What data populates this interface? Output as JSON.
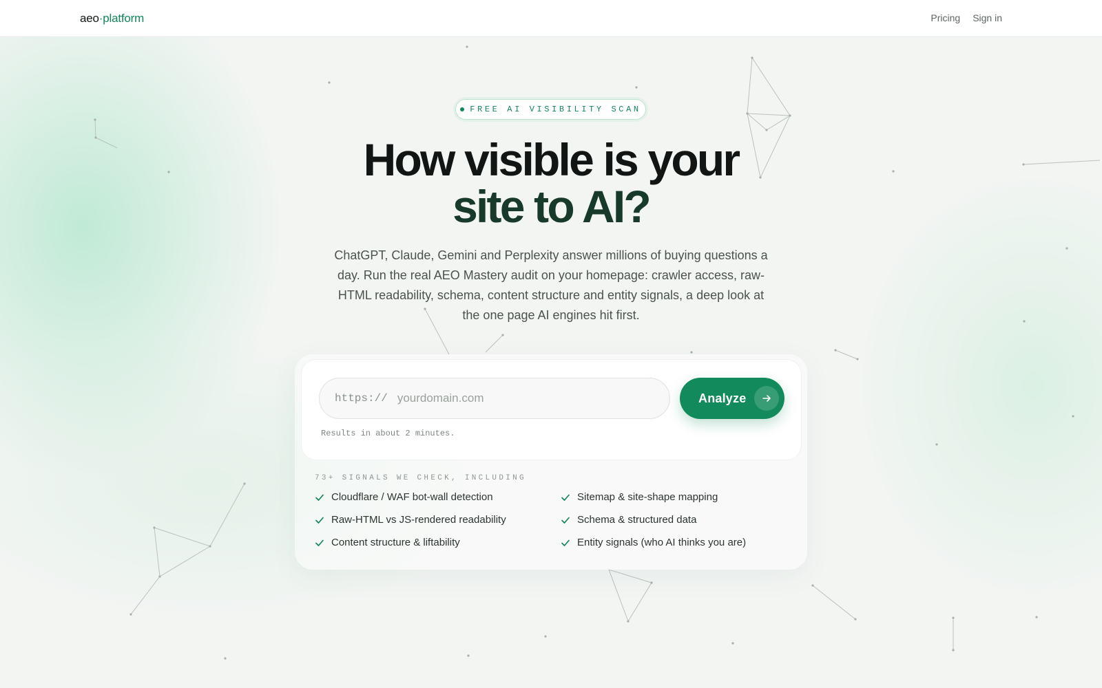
{
  "header": {
    "brand": {
      "part1": "aeo",
      "dot": "·",
      "part2": "platform"
    },
    "nav": [
      {
        "label": "Pricing"
      },
      {
        "label": "Sign in"
      }
    ]
  },
  "hero": {
    "badge": "FREE AI VISIBILITY SCAN",
    "title_line1": "How visible is your",
    "title_line2": "site to AI?",
    "lede": "ChatGPT, Claude, Gemini and Perplexity answer millions of buying questions a day. Run the real AEO Mastery audit on your homepage: crawler access, raw-HTML readability, schema, content structure and entity signals, a deep look at the one page AI engines hit first."
  },
  "form": {
    "url_prefix": "https://",
    "url_value": "",
    "url_placeholder": "yourdomain.com",
    "submit_label": "Analyze",
    "hint": "Results in about 2 minutes."
  },
  "signals": {
    "heading": "73+ SIGNALS WE CHECK, INCLUDING",
    "items": [
      {
        "label": "Cloudflare / WAF bot-wall detection"
      },
      {
        "label": "Sitemap & site-shape mapping"
      },
      {
        "label": "Raw-HTML vs JS-rendered readability"
      },
      {
        "label": "Schema & structured data"
      },
      {
        "label": "Content structure & liftability"
      },
      {
        "label": "Entity signals (who AI thinks you are)"
      }
    ]
  },
  "colors": {
    "accent": "#128a5b",
    "accent_text": "#13855a",
    "background": "#f3f5f3",
    "title": "#111514"
  },
  "icons": {
    "check": "check-icon",
    "arrow": "arrow-right-icon",
    "status_dot": "status-dot-icon"
  }
}
